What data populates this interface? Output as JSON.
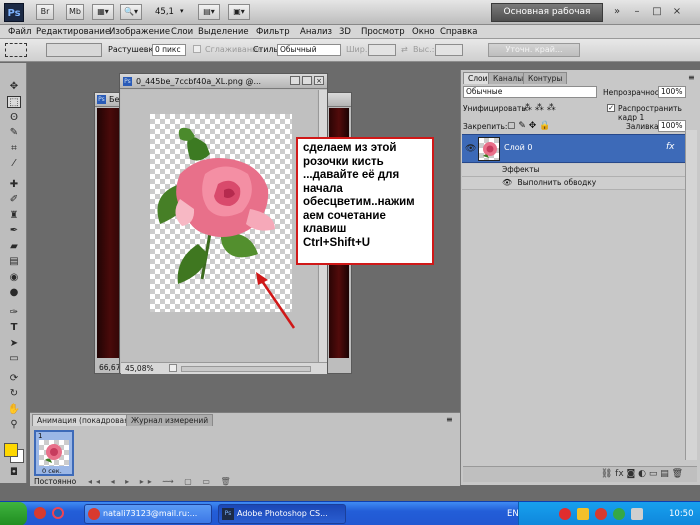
{
  "appbar": {
    "logo": "Ps",
    "mb_btn": "Mb",
    "zoom": "45,1",
    "workspace": "Основная рабочая среда",
    "controls": [
      "»",
      "–",
      "□",
      "×"
    ]
  },
  "menu": [
    "Файл",
    "Редактирование",
    "Изображение",
    "Слои",
    "Выделение",
    "Фильтр",
    "Анализ",
    "3D",
    "Просмотр",
    "Окно",
    "Справка"
  ],
  "options": {
    "feather_label": "Растушевка:",
    "feather_value": "0 пикс",
    "antialias_label": "Сглаживание",
    "style_label": "Стиль:",
    "style_value": "Обычный",
    "width_label": "Шир.:",
    "height_label": "Выс.:",
    "refine_edge": "Уточн. край..."
  },
  "documents": {
    "back_title": "Бе",
    "back_zoom": "66,67",
    "front_title": "0_445be_7ccbf40a_XL.png @...",
    "front_zoom": "45,08%"
  },
  "callout": {
    "lines": [
      "сделаем из этой",
      "розочки кисть",
      "...давайте её для",
      "начала",
      "обесцветим..нажим",
      "аем сочетание",
      "клавиш",
      "Ctrl+Shift+U"
    ]
  },
  "layers_panel": {
    "tabs": [
      "Слои",
      "Каналы",
      "Контуры"
    ],
    "blend_mode": "Обычные",
    "opacity_label": "Непрозрачность:",
    "opacity_value": "100%",
    "unify_label": "Унифицировать:",
    "propagate_label": "Распространить кадр 1",
    "lock_label": "Закрепить:",
    "fill_label": "Заливка:",
    "fill_value": "100%",
    "layer_name": "Слой 0",
    "effects_label": "Эффекты",
    "stroke_label": "Выполнить обводку"
  },
  "animation_panel": {
    "tabs": [
      "Анимация (покадровая)",
      "Журнал измерений"
    ],
    "frame_number": "1",
    "frame_delay": "0 сек.",
    "loop": "Постоянно"
  },
  "taskbar": {
    "mail_task": "natali73123@mail.ru:...",
    "ps_task": "Adobe Photoshop CS...",
    "language": "EN",
    "clock": "10:50"
  },
  "colors": {
    "foreground": "#ffd800",
    "background": "#ffffff",
    "callout_border": "#d01818",
    "selected_layer": "#3d6ab8",
    "workspace_bg": "#6b6b6b"
  }
}
